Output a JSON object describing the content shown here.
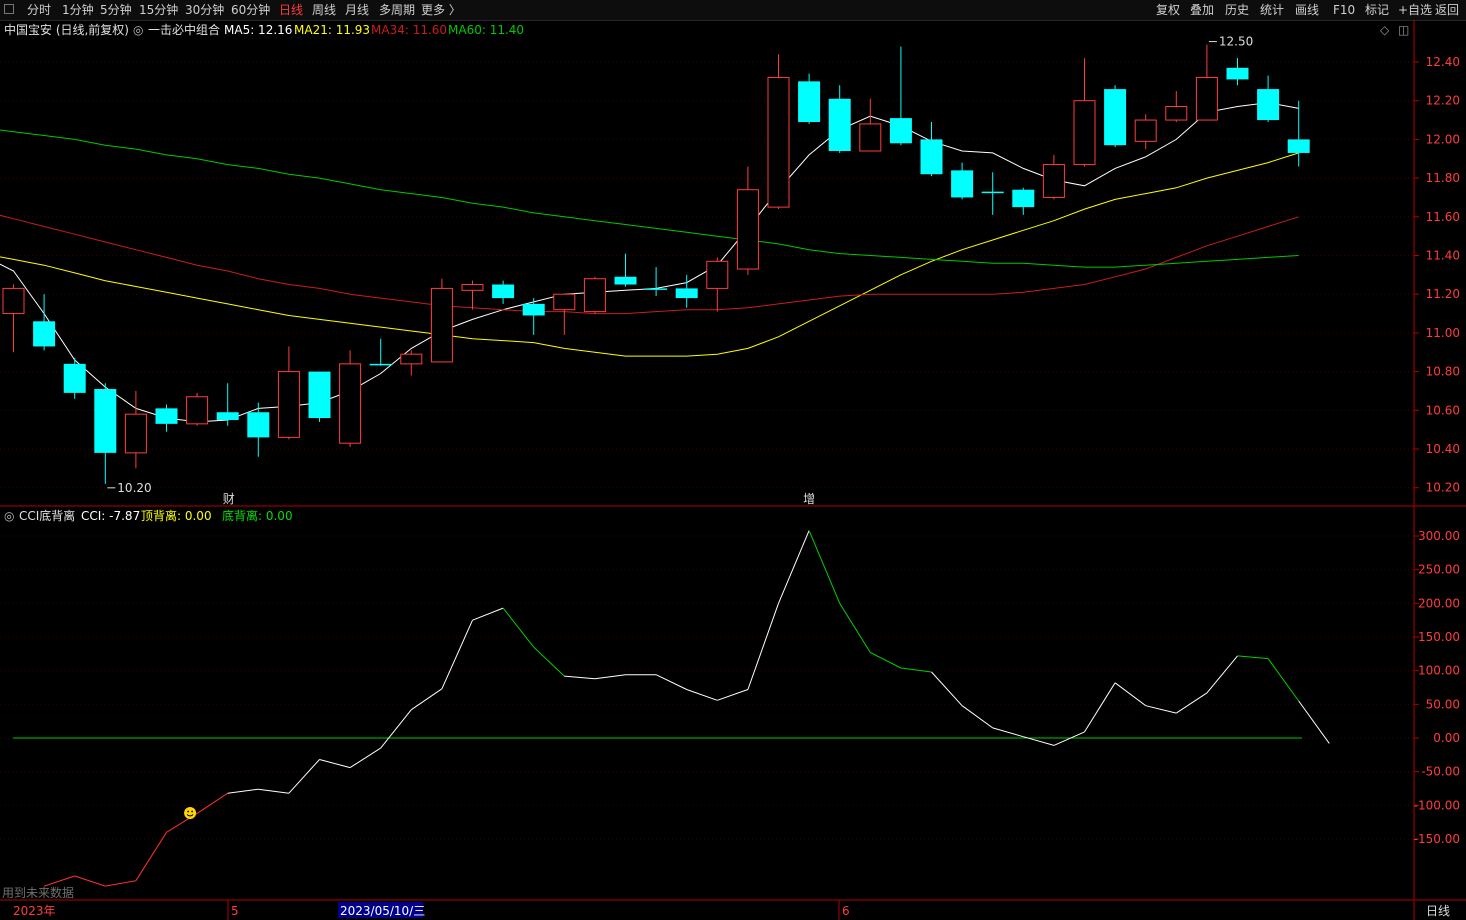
{
  "toolbar": {
    "left_items": [
      "分时",
      "1分钟",
      "5分钟",
      "15分钟",
      "30分钟",
      "60分钟",
      "日线",
      "周线",
      "月线",
      "多周期",
      "更多 〉"
    ],
    "active_item": "日线",
    "right_items": [
      "复权",
      "叠加",
      "历史",
      "统计",
      "画线",
      "F10",
      "标记",
      "+自选",
      "返回"
    ]
  },
  "main_info": {
    "stock": "中国宝安 (日线,前复权)",
    "indicator": "一击必中组合",
    "ma5": "MA5: 12.16",
    "ma21": "MA21: 11.93",
    "ma34": "MA34: 11.60",
    "ma60": "MA60: 11.40"
  },
  "cci_info": {
    "name": "CCI底背离",
    "cci": "CCI: -7.87",
    "top": "顶背离: 0.00",
    "bottom": "底背离: 0.00"
  },
  "colors": {
    "up": "#ff3c3c",
    "down": "#00ffff",
    "ma5": "#ffffff",
    "ma21": "#ffff00",
    "ma34": "#c81e1e",
    "ma60": "#00c800",
    "axis": "#b40000",
    "grid": "#3a0000"
  },
  "chart_data": [
    {
      "type": "candlestick",
      "y_axis": {
        "ticks": [
          "12.40",
          "12.20",
          "12.00",
          "11.80",
          "11.60",
          "11.40",
          "11.20",
          "11.00",
          "10.80",
          "10.60",
          "10.40",
          "10.20"
        ],
        "ylim": [
          10.12,
          12.57
        ]
      },
      "x_axis": {
        "labels": [
          "2023年",
          "5",
          "2023/05/10/三",
          "6"
        ],
        "period_label": "日线"
      },
      "annotations": {
        "low": "10.20",
        "high": "12.50",
        "marker_cai": "财",
        "marker_zeng": "增",
        "bottom_left_note": "用到未来数据"
      },
      "candles": [
        {
          "o": 11.1,
          "h": 11.25,
          "l": 10.9,
          "c": 11.23
        },
        {
          "o": 11.06,
          "h": 11.2,
          "l": 10.91,
          "c": 10.93
        },
        {
          "o": 10.84,
          "h": 10.87,
          "l": 10.66,
          "c": 10.69
        },
        {
          "o": 10.71,
          "h": 10.74,
          "l": 10.22,
          "c": 10.38
        },
        {
          "o": 10.38,
          "h": 10.7,
          "l": 10.3,
          "c": 10.58
        },
        {
          "o": 10.61,
          "h": 10.63,
          "l": 10.49,
          "c": 10.53
        },
        {
          "o": 10.53,
          "h": 10.69,
          "l": 10.52,
          "c": 10.67
        },
        {
          "o": 10.59,
          "h": 10.74,
          "l": 10.52,
          "c": 10.55
        },
        {
          "o": 10.59,
          "h": 10.64,
          "l": 10.36,
          "c": 10.46
        },
        {
          "o": 10.46,
          "h": 10.93,
          "l": 10.45,
          "c": 10.8
        },
        {
          "o": 10.8,
          "h": 10.8,
          "l": 10.54,
          "c": 10.56
        },
        {
          "o": 10.43,
          "h": 10.91,
          "l": 10.41,
          "c": 10.84
        },
        {
          "o": 10.84,
          "h": 10.97,
          "l": 10.83,
          "c": 10.84
        },
        {
          "o": 10.84,
          "h": 10.91,
          "l": 10.78,
          "c": 10.89
        },
        {
          "o": 10.85,
          "h": 11.28,
          "l": 10.85,
          "c": 11.23
        },
        {
          "o": 11.22,
          "h": 11.27,
          "l": 11.12,
          "c": 11.25
        },
        {
          "o": 11.25,
          "h": 11.27,
          "l": 11.15,
          "c": 11.18
        },
        {
          "o": 11.15,
          "h": 11.18,
          "l": 10.99,
          "c": 11.09
        },
        {
          "o": 11.12,
          "h": 11.2,
          "l": 10.99,
          "c": 11.2
        },
        {
          "o": 11.11,
          "h": 11.29,
          "l": 11.1,
          "c": 11.28
        },
        {
          "o": 11.29,
          "h": 11.41,
          "l": 11.24,
          "c": 11.25
        },
        {
          "o": 11.23,
          "h": 11.34,
          "l": 11.19,
          "c": 11.23
        },
        {
          "o": 11.23,
          "h": 11.3,
          "l": 11.13,
          "c": 11.18
        },
        {
          "o": 11.23,
          "h": 11.39,
          "l": 11.11,
          "c": 11.37
        },
        {
          "o": 11.33,
          "h": 11.86,
          "l": 11.3,
          "c": 11.74
        },
        {
          "o": 11.65,
          "h": 12.44,
          "l": 11.64,
          "c": 12.32
        },
        {
          "o": 12.3,
          "h": 12.34,
          "l": 12.08,
          "c": 12.09
        },
        {
          "o": 12.21,
          "h": 12.28,
          "l": 11.93,
          "c": 11.94
        },
        {
          "o": 11.94,
          "h": 12.21,
          "l": 11.94,
          "c": 12.08
        },
        {
          "o": 12.11,
          "h": 12.48,
          "l": 11.97,
          "c": 11.98
        },
        {
          "o": 12.0,
          "h": 12.09,
          "l": 11.81,
          "c": 11.82
        },
        {
          "o": 11.84,
          "h": 11.88,
          "l": 11.69,
          "c": 11.7
        },
        {
          "o": 11.73,
          "h": 11.83,
          "l": 11.61,
          "c": 11.73
        },
        {
          "o": 11.74,
          "h": 11.75,
          "l": 11.61,
          "c": 11.65
        },
        {
          "o": 11.7,
          "h": 11.92,
          "l": 11.69,
          "c": 11.87
        },
        {
          "o": 11.87,
          "h": 12.42,
          "l": 11.86,
          "c": 12.2
        },
        {
          "o": 12.26,
          "h": 12.28,
          "l": 11.96,
          "c": 11.97
        },
        {
          "o": 11.99,
          "h": 12.13,
          "l": 11.95,
          "c": 12.1
        },
        {
          "o": 12.1,
          "h": 12.25,
          "l": 12.09,
          "c": 12.17
        },
        {
          "o": 12.1,
          "h": 12.49,
          "l": 12.1,
          "c": 12.32
        },
        {
          "o": 12.37,
          "h": 12.42,
          "l": 12.28,
          "c": 12.31
        },
        {
          "o": 12.26,
          "h": 12.33,
          "l": 12.09,
          "c": 12.1
        },
        {
          "o": 12.0,
          "h": 12.2,
          "l": 11.86,
          "c": 11.93
        }
      ],
      "series": [
        {
          "name": "MA5",
          "values": [
            11.4,
            11.32,
            11.1,
            10.86,
            10.72,
            10.61,
            10.56,
            10.54,
            10.55,
            10.61,
            10.62,
            10.64,
            10.7,
            10.79,
            10.92,
            11.01,
            11.07,
            11.12,
            11.16,
            11.2,
            11.21,
            11.22,
            11.23,
            11.26,
            11.35,
            11.54,
            11.74,
            11.92,
            12.05,
            12.12,
            12.07,
            11.99,
            11.94,
            11.93,
            11.85,
            11.79,
            11.76,
            11.85,
            11.91,
            12.0,
            12.14,
            12.17,
            12.19,
            12.16
          ]
        },
        {
          "name": "MA21",
          "values": [
            11.45,
            11.41,
            11.38,
            11.35,
            11.31,
            11.27,
            11.24,
            11.21,
            11.18,
            11.15,
            11.12,
            11.09,
            11.07,
            11.05,
            11.03,
            11.01,
            10.99,
            10.97,
            10.96,
            10.95,
            10.92,
            10.9,
            10.88,
            10.88,
            10.88,
            10.89,
            10.92,
            10.98,
            11.06,
            11.14,
            11.22,
            11.3,
            11.37,
            11.43,
            11.48,
            11.53,
            11.58,
            11.64,
            11.69,
            11.72,
            11.75,
            11.8,
            11.84,
            11.88,
            11.93
          ]
        },
        {
          "name": "MA34",
          "values": [
            11.66,
            11.63,
            11.59,
            11.55,
            11.51,
            11.47,
            11.43,
            11.39,
            11.35,
            11.32,
            11.28,
            11.25,
            11.23,
            11.2,
            11.18,
            11.16,
            11.14,
            11.13,
            11.12,
            11.11,
            11.11,
            11.1,
            11.1,
            11.11,
            11.12,
            11.12,
            11.13,
            11.15,
            11.17,
            11.19,
            11.2,
            11.2,
            11.2,
            11.2,
            11.2,
            11.21,
            11.23,
            11.25,
            11.29,
            11.33,
            11.39,
            11.45,
            11.5,
            11.55,
            11.6
          ]
        },
        {
          "name": "MA60",
          "values": [
            12.07,
            12.06,
            12.04,
            12.02,
            12.0,
            11.97,
            11.95,
            11.92,
            11.9,
            11.87,
            11.85,
            11.82,
            11.8,
            11.77,
            11.74,
            11.72,
            11.7,
            11.67,
            11.65,
            11.62,
            11.6,
            11.58,
            11.56,
            11.54,
            11.52,
            11.5,
            11.48,
            11.46,
            11.43,
            11.41,
            11.4,
            11.39,
            11.38,
            11.37,
            11.36,
            11.36,
            11.35,
            11.34,
            11.34,
            11.35,
            11.36,
            11.37,
            11.38,
            11.39,
            11.4
          ]
        }
      ]
    },
    {
      "type": "line",
      "y_axis": {
        "ticks": [
          "300.00",
          "250.00",
          "200.00",
          "150.00",
          "100.00",
          "50.00",
          "0.00",
          "-50.00",
          "-100.00",
          "-150.00"
        ],
        "ylim": [
          -230,
          320
        ]
      },
      "series": [
        {
          "name": "CCI",
          "values": [
            -220,
            -205,
            -220,
            -212,
            -140,
            -112,
            -82,
            -76,
            -82,
            -32,
            -44,
            -15,
            42,
            73,
            175,
            193,
            135,
            92,
            88,
            94,
            94,
            72,
            56,
            72,
            200,
            308,
            200,
            127,
            104,
            98,
            48,
            15,
            2,
            -11,
            9,
            82,
            48,
            37,
            67,
            122,
            118,
            55,
            -8
          ]
        }
      ],
      "zero_line": 0,
      "marker": "smiley"
    }
  ]
}
